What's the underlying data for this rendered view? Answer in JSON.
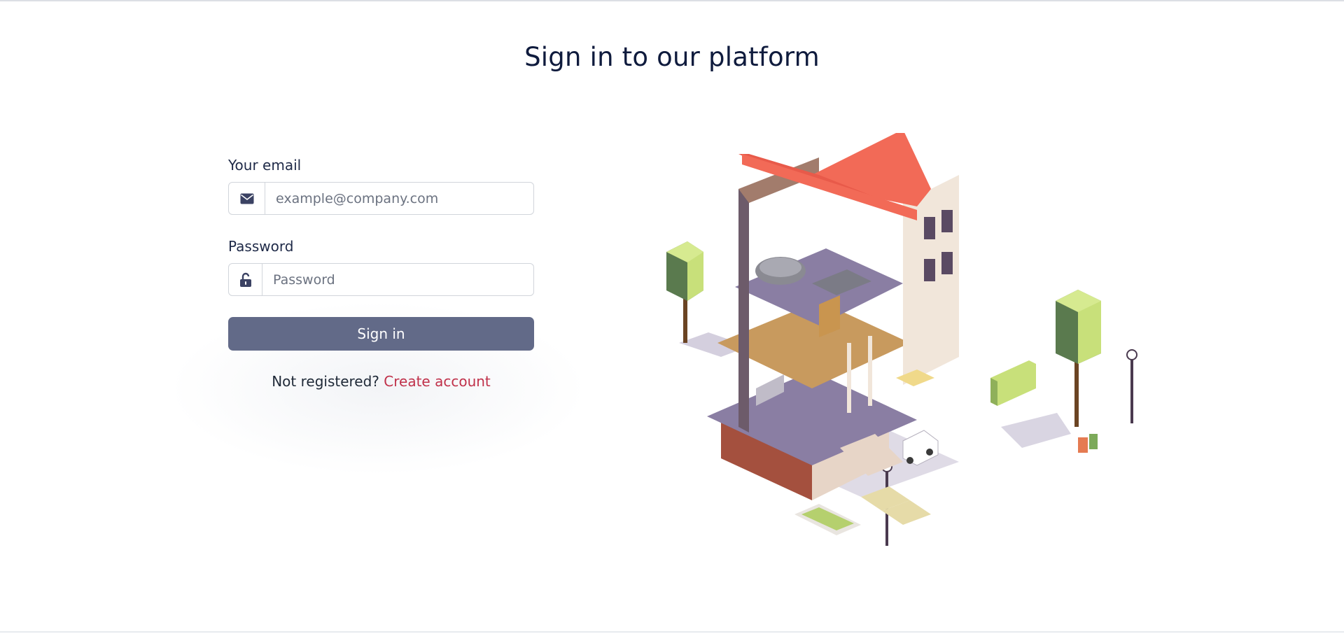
{
  "page": {
    "title": "Sign in to our platform"
  },
  "form": {
    "email_label": "Your email",
    "email_placeholder": "example@company.com",
    "email_icon": "envelope-icon",
    "password_label": "Password",
    "password_placeholder": "Password",
    "password_icon": "unlock-icon",
    "submit_label": "Sign in"
  },
  "register": {
    "prompt": "Not registered?",
    "link_label": "Create account"
  },
  "colors": {
    "title": "#0f1b3d",
    "button": "#626a88",
    "link": "#c0314a",
    "roof": "#f26a57",
    "tree": "#c8e07a"
  },
  "illustration": {
    "subject": "isometric cutaway house"
  }
}
